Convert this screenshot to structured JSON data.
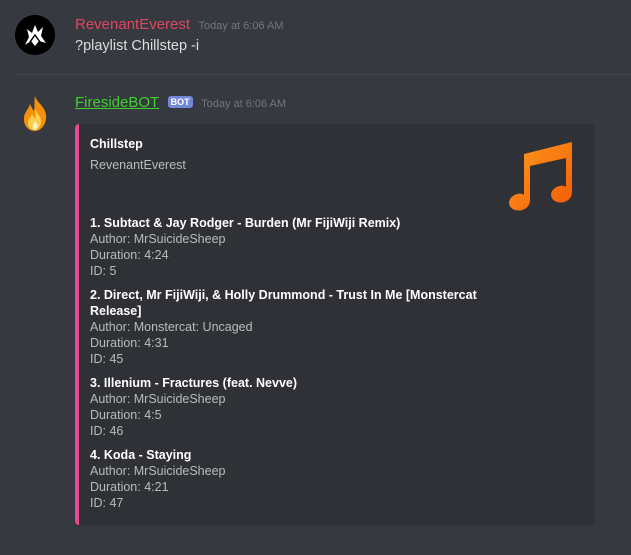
{
  "messages": [
    {
      "username": "RevenantEverest",
      "timestamp": "Today at 6:06 AM",
      "content": "?playlist Chillstep -i",
      "avatar_icon": "wolf-logo-icon"
    },
    {
      "username": "FiresideBOT",
      "bot_tag": "BOT",
      "timestamp": "Today at 6:06 AM",
      "avatar_icon": "fire-emoji-icon",
      "embed": {
        "accent_color": "#e8488d",
        "title": "Chillstep",
        "description": "RevenantEverest",
        "thumbnail_icon": "music-note-icon",
        "fields": [
          {
            "name": "1. Subtact & Jay Rodger - Burden (Mr FijiWiji Remix)",
            "author": "Author: MrSuicideSheep",
            "duration": "Duration: 4:24",
            "id": "ID: 5"
          },
          {
            "name_line1": "2. Direct, Mr FijiWiji, & Holly Drummond - Trust In Me [Monstercat",
            "name_line2": "Release]",
            "author": "Author: Monstercat: Uncaged",
            "duration": "Duration: 4:31",
            "id": "ID: 45"
          },
          {
            "name": "3. Illenium - Fractures (feat. Nevve)",
            "author": "Author: MrSuicideSheep",
            "duration": "Duration: 4:5",
            "id": "ID: 46"
          },
          {
            "name": "4. Koda - Staying",
            "author": "Author: MrSuicideSheep",
            "duration": "Duration: 4:21",
            "id": "ID: 47"
          }
        ]
      }
    }
  ]
}
